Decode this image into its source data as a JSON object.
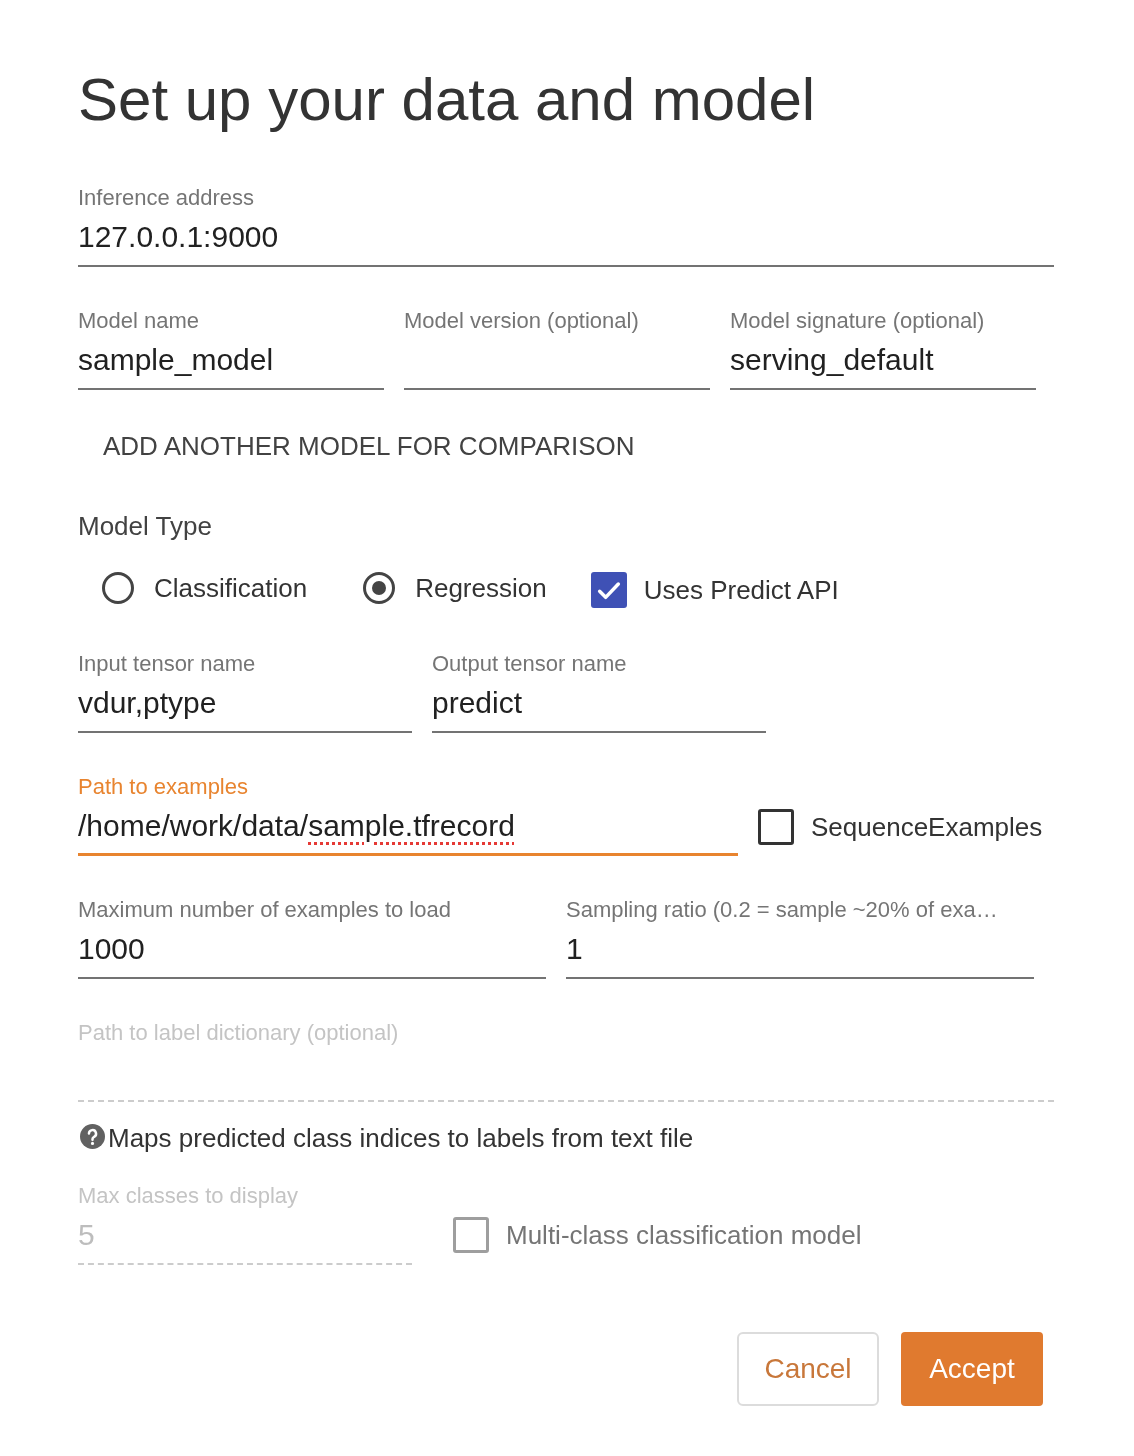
{
  "title": "Set up your data and model",
  "inference_address": {
    "label": "Inference address",
    "value": "127.0.0.1:9000",
    "focused": false,
    "disabled": false
  },
  "model_fields": [
    {
      "label": "Model name",
      "value": "sample_model",
      "focused": false,
      "disabled": false
    },
    {
      "label": "Model version (optional)",
      "focused": false,
      "disabled": false
    },
    {
      "label": "Model signature (optional)",
      "value": "serving_default",
      "focused": false,
      "disabled": false
    }
  ],
  "add_model_button": {
    "label": "ADD ANOTHER MODEL FOR COMPARISON"
  },
  "model_type": {
    "label": "Model Type",
    "options": [
      {
        "label": "Classification",
        "selected": false
      },
      {
        "label": "Regression",
        "selected": true
      }
    ],
    "predict_api": {
      "label": "Uses Predict API",
      "checked": true,
      "disabled": false
    }
  },
  "tensor_fields": [
    {
      "label": "Input tensor name",
      "value": "vdur,ptype",
      "focused": false,
      "disabled": false
    },
    {
      "label": "Output tensor name",
      "value": "predict",
      "focused": false,
      "disabled": false
    }
  ],
  "examples_path": {
    "label": "Path to examples",
    "value_parts": [
      {
        "text": "/home/work/data/",
        "misspelled": false
      },
      {
        "text": "sample.tfrecord",
        "misspelled": true
      }
    ],
    "focused": true,
    "disabled": false
  },
  "sequence_examples": {
    "label": "SequenceExamples",
    "checked": false,
    "disabled": false
  },
  "example_limits": [
    {
      "label": "Maximum number of examples to load",
      "value": "1000",
      "focused": false,
      "disabled": false
    },
    {
      "label": "Sampling ratio (0.2 = sample ~20% of exa…",
      "value": "1",
      "focused": false,
      "disabled": false
    }
  ],
  "label_dictionary": {
    "label": "Path to label dictionary (optional)",
    "focused": false,
    "disabled": true
  },
  "help_text": "Maps predicted class indices to labels from text file",
  "max_classes": {
    "label": "Max classes to display",
    "value": "5",
    "focused": false,
    "disabled": true
  },
  "multi_class": {
    "label": "Multi-class classification model",
    "checked": false,
    "disabled": true
  },
  "buttons": [
    {
      "label": "Cancel",
      "kind": "outlined"
    },
    {
      "label": "Accept",
      "kind": "filled"
    }
  ]
}
